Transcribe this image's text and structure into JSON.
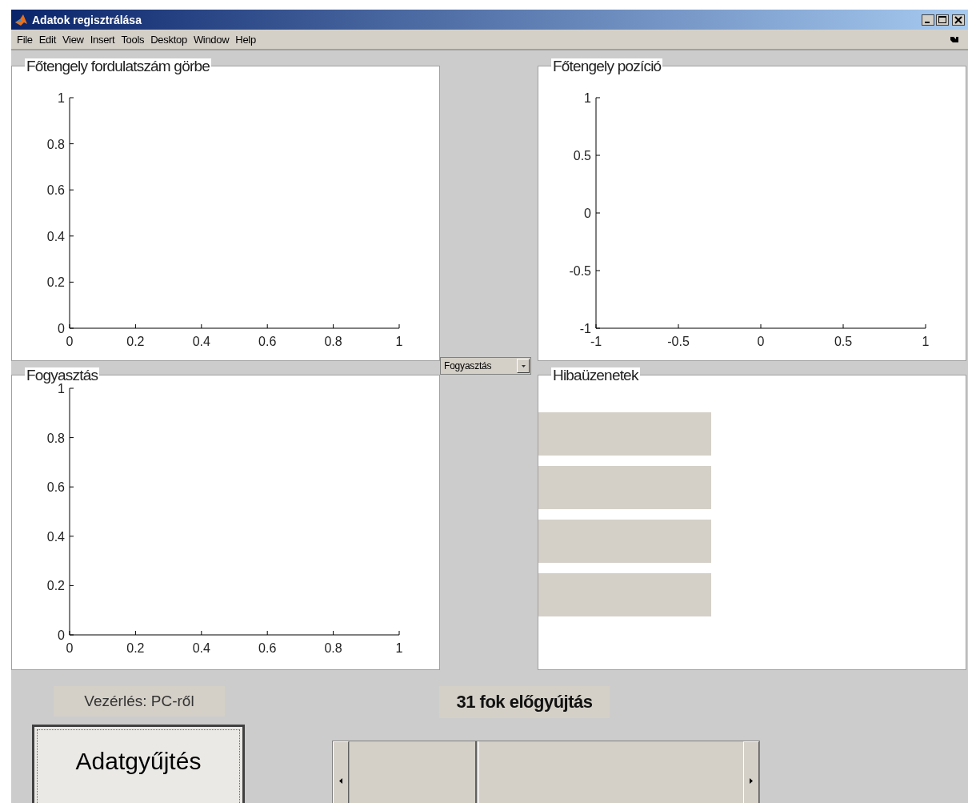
{
  "window": {
    "title": "Adatok regisztrálása"
  },
  "menu": [
    "File",
    "Edit",
    "View",
    "Insert",
    "Tools",
    "Desktop",
    "Window",
    "Help"
  ],
  "panels": [
    {
      "title": "Főtengely fordulatszám görbe",
      "chart_data": {
        "type": "line",
        "xlim": [
          0,
          1
        ],
        "ylim": [
          0,
          1
        ],
        "xticks": [
          0,
          0.2,
          0.4,
          0.6,
          0.8,
          1
        ],
        "yticks": [
          0,
          0.2,
          0.4,
          0.6,
          0.8,
          1
        ]
      }
    },
    {
      "title": "Főtengely pozíció",
      "chart_data": {
        "type": "line",
        "xlim": [
          -1,
          1
        ],
        "ylim": [
          -1,
          1
        ],
        "xticks": [
          -1,
          -0.5,
          0,
          0.5,
          1
        ],
        "yticks": [
          -1,
          -0.5,
          0,
          0.5,
          1
        ]
      }
    },
    {
      "title": "Fogyasztás",
      "chart_data": {
        "type": "line",
        "xlim": [
          0,
          1
        ],
        "ylim": [
          0,
          1
        ],
        "xticks": [
          0,
          0.2,
          0.4,
          0.6,
          0.8,
          1
        ],
        "yticks": [
          0,
          0.2,
          0.4,
          0.6,
          0.8,
          1
        ]
      }
    },
    {
      "title": "Hibaüzenetek",
      "message_fields": [
        {
          "kind": "empty"
        },
        {
          "kind": "empty"
        },
        {
          "kind": "empty"
        },
        {
          "kind": "empty"
        }
      ]
    }
  ],
  "dropdown": {
    "value": "Fogyasztás"
  },
  "control_label": "Vezérlés: PC-ről",
  "ignition_label": "31 fok előgyújtás",
  "collect_button": "Adatgyűjtés",
  "slider": {
    "level": 0.32
  }
}
